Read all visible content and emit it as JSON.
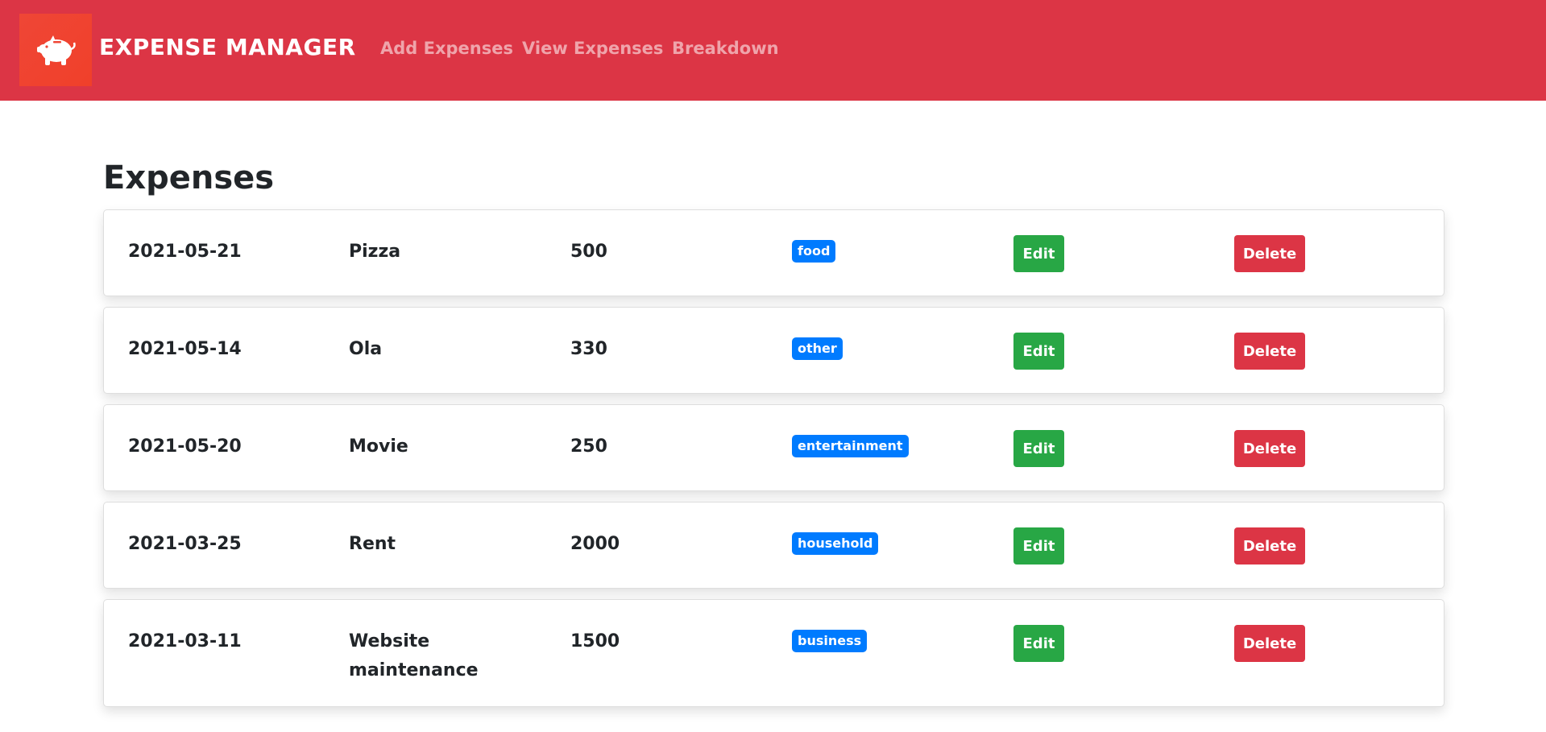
{
  "nav": {
    "brand": "EXPENSE MANAGER",
    "links": [
      "Add Expenses",
      "View Expenses",
      "Breakdown"
    ],
    "logo_icon": "piggy-bank-icon"
  },
  "page": {
    "title": "Expenses"
  },
  "colors": {
    "navbar": "#dc3545",
    "badge": "#007bff",
    "edit": "#28a745",
    "delete": "#dc3545"
  },
  "actions": {
    "edit_label": "Edit",
    "delete_label": "Delete"
  },
  "expenses": [
    {
      "date": "2021-05-21",
      "name": "Pizza",
      "amount": "500",
      "category": "food"
    },
    {
      "date": "2021-05-14",
      "name": "Ola",
      "amount": "330",
      "category": "other"
    },
    {
      "date": "2021-05-20",
      "name": "Movie",
      "amount": "250",
      "category": "entertainment"
    },
    {
      "date": "2021-03-25",
      "name": "Rent",
      "amount": "2000",
      "category": "household"
    },
    {
      "date": "2021-03-11",
      "name": "Website maintenance",
      "amount": "1500",
      "category": "business"
    }
  ]
}
